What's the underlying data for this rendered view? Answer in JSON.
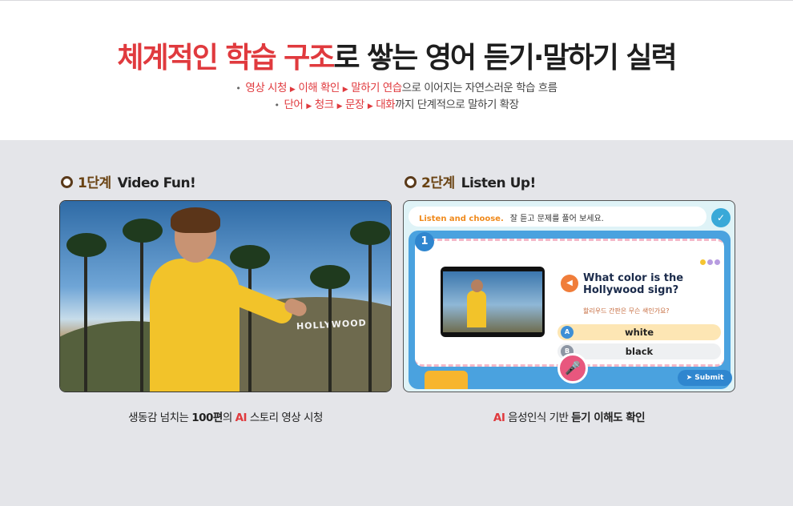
{
  "headline": {
    "part1": "체계적인 학습 구조",
    "part2": "로 쌓는 영어 듣기·말하기 실력"
  },
  "subline1": {
    "a": "영상 시청",
    "b": "이해 확인",
    "c": "말하기 연습",
    "rest": "으로 이어지는 자연스러운 학습 흐름"
  },
  "subline2": {
    "a": "단어",
    "b": "청크",
    "c": "문장",
    "d": "대화",
    "rest": "까지 단계적으로 말하기 확장"
  },
  "step1": {
    "stage": "1단계",
    "title": "Video Fun!",
    "sign": "HOLLYWOOD",
    "caption": {
      "pre": "생동감 넘치는 ",
      "num": "100편",
      "mid": "의 ",
      "ai": "AI",
      "post": " 스토리 영상 시청"
    }
  },
  "step2": {
    "stage": "2단계",
    "title": "Listen Up!",
    "caption": {
      "ai": "AI",
      "mid": " 음성인식 기반 ",
      "b1": "듣기 이해도 확인"
    }
  },
  "quiz": {
    "instruction_label": "Listen and choose.",
    "instruction_ko": "잘 듣고 문제를 풀어 보세요.",
    "number": "1",
    "question_line1": "What color is the",
    "question_line2": "Hollywood sign?",
    "question_ko": "할리우드 간판은 무슨 색인가요?",
    "options": [
      {
        "key": "A",
        "label": "white"
      },
      {
        "key": "B",
        "label": "black"
      }
    ],
    "submit_label": "Submit",
    "colors": {
      "accent": "#2f86cf",
      "highlight": "#fde6b4",
      "mic": "#e8577e"
    }
  },
  "icons": {
    "check": "chevron-down-icon",
    "speaker": "speaker-icon",
    "mic": "microphone-icon",
    "submit": "arrow-right-icon"
  }
}
